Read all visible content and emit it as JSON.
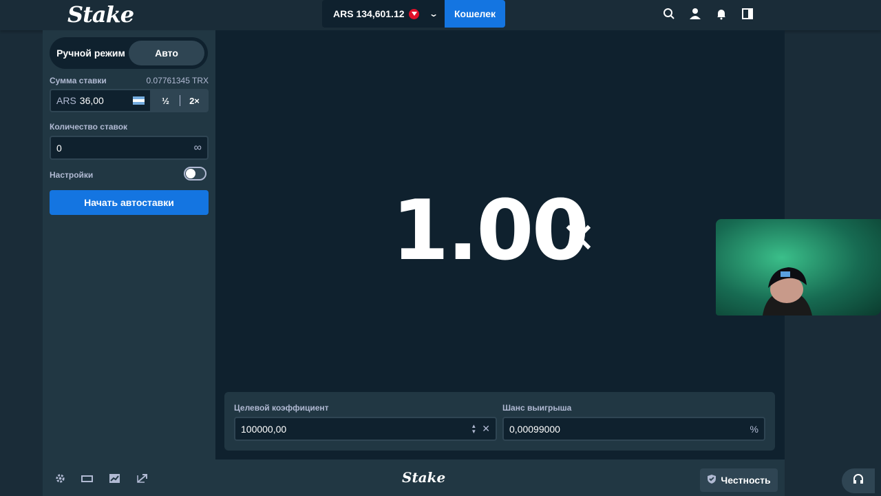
{
  "header": {
    "logo": "Stake",
    "balance": "ARS 134,601.12",
    "wallet_label": "Кошелек"
  },
  "sidebar": {
    "mode_manual": "Ручной режим",
    "mode_auto": "Авто",
    "bet_amount_label": "Сумма ставки",
    "bet_amount_converted": "0.07761345 TRX",
    "bet_currency": "ARS",
    "bet_value": "36,00",
    "half_label": "½",
    "double_label": "2×",
    "bet_count_label": "Количество ставок",
    "bet_count_value": "0",
    "settings_label": "Настройки",
    "start_label": "Начать автоставки"
  },
  "game": {
    "multiplier": "1.00",
    "multiplier_suffix": "×",
    "target_label": "Целевой коэффициент",
    "target_value": "100000,00",
    "win_chance_label": "Шанс выигрыша",
    "win_chance_value": "0,00099000",
    "percent_symbol": "%"
  },
  "footer": {
    "logo": "Stake",
    "fairness_label": "Честность"
  },
  "colors": {
    "background": "#1a2c38",
    "panel": "#213743",
    "input": "#0f212e",
    "accent": "#1475e1"
  }
}
